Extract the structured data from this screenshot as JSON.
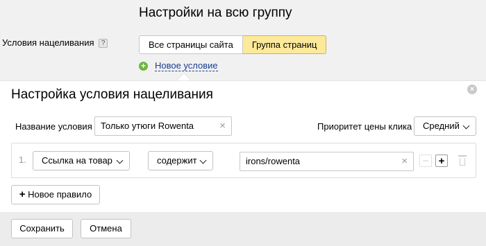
{
  "header": {
    "title": "Настройки на всю группу",
    "targeting_label": "Условия нацеливания",
    "help_glyph": "?",
    "segmented": {
      "all_pages": "Все страницы сайта",
      "page_group": "Группа страниц",
      "selected": "Группа страниц"
    },
    "new_condition_link": "Новое условие"
  },
  "panel": {
    "title": "Настройка условия нацеливания",
    "close_glyph": "×",
    "condition_name_label": "Название условия",
    "condition_name_value": "Только утюги Rowenta",
    "priority_label": "Приоритет цены клика",
    "priority_value": "Средний",
    "rule": {
      "number": "1.",
      "field": "Ссылка на товар",
      "operator": "содержит",
      "value": "irons/rowenta"
    },
    "new_rule_button": "Новое правило"
  },
  "footer": {
    "save_button": "Сохранить",
    "cancel_button": "Отмена"
  },
  "colors": {
    "accent_selected": "#fde99a",
    "link": "#1b3d8f",
    "add_icon": "#6eb541"
  }
}
